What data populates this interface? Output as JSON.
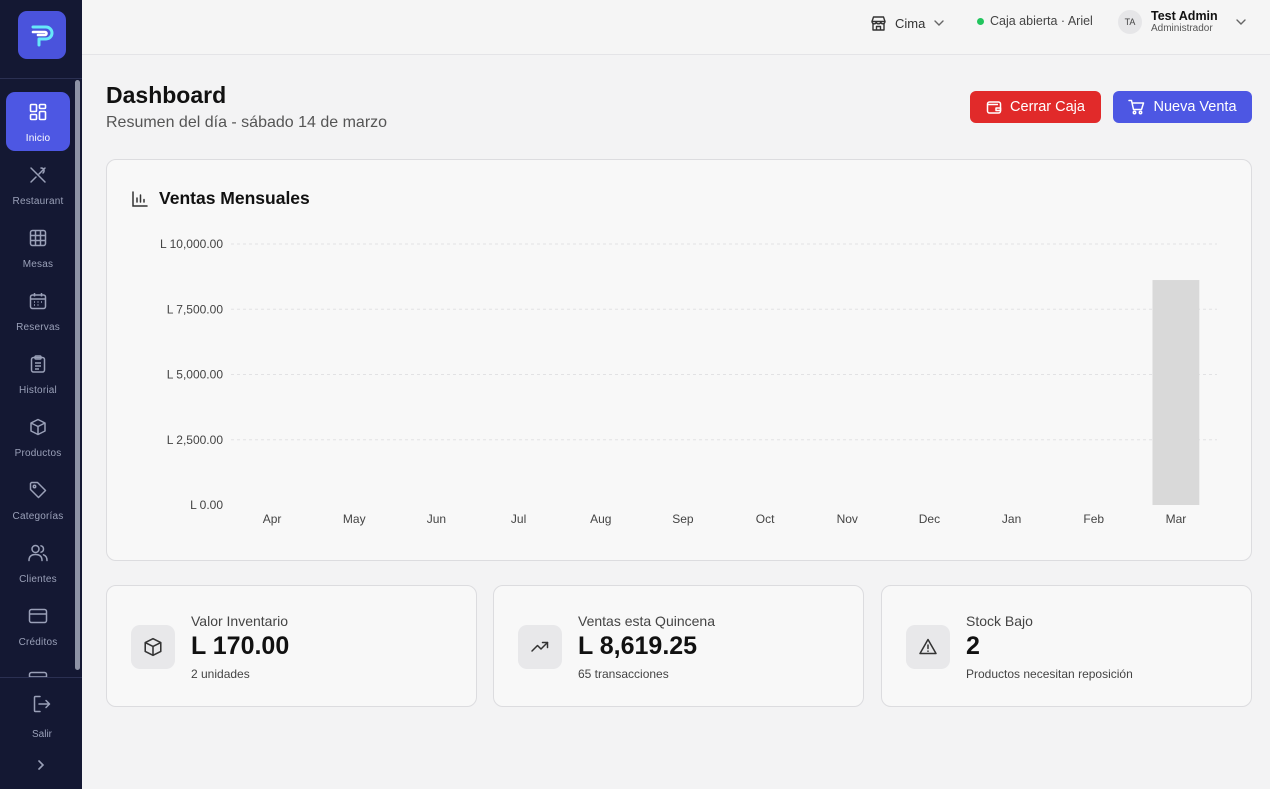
{
  "sidebar": {
    "logo": "P",
    "items": [
      {
        "label": "Inicio",
        "icon": "grid-icon",
        "active": true
      },
      {
        "label": "Restaurant",
        "icon": "utensils-icon"
      },
      {
        "label": "Mesas",
        "icon": "table-icon"
      },
      {
        "label": "Reservas",
        "icon": "calendar-icon"
      },
      {
        "label": "Historial",
        "icon": "clipboard-icon"
      },
      {
        "label": "Productos",
        "icon": "box-icon"
      },
      {
        "label": "Categorías",
        "icon": "tag-icon"
      },
      {
        "label": "Clientes",
        "icon": "users-icon"
      },
      {
        "label": "Créditos",
        "icon": "credit-card-icon"
      }
    ],
    "logout_label": "Salir"
  },
  "topbar": {
    "branch": "Cima",
    "status": "Caja abierta · Ariel",
    "status_color": "#22c55e",
    "user_initials": "TA",
    "user_name": "Test Admin",
    "user_role": "Administrador"
  },
  "header": {
    "title": "Dashboard",
    "subtitle": "Resumen del día - sábado 14 de marzo",
    "close_label": "Cerrar Caja",
    "new_sale_label": "Nueva Venta"
  },
  "colors": {
    "accent": "#4d57e3",
    "danger": "#e12a2a",
    "sidebar": "#141833",
    "bar": "#d9d9d9"
  },
  "chart_data": {
    "type": "bar",
    "title": "Ventas Mensuales",
    "categories": [
      "Apr",
      "May",
      "Jun",
      "Jul",
      "Aug",
      "Sep",
      "Oct",
      "Nov",
      "Dec",
      "Jan",
      "Feb",
      "Mar"
    ],
    "values": [
      0,
      0,
      0,
      0,
      0,
      0,
      0,
      0,
      0,
      0,
      0,
      8619.25
    ],
    "yticks": [
      0,
      2500,
      5000,
      7500,
      10000
    ],
    "ytick_labels": [
      "L 0.00",
      "L 2,500.00",
      "L 5,000.00",
      "L 7,500.00",
      "L 10,000.00"
    ],
    "ylim": [
      0,
      10000
    ],
    "grid": true
  },
  "stats": [
    {
      "label": "Valor Inventario",
      "value": "L 170.00",
      "note": "2 unidades",
      "icon": "box-icon"
    },
    {
      "label": "Ventas esta Quincena",
      "value": "L 8,619.25",
      "note": "65 transacciones",
      "icon": "trending-up-icon"
    },
    {
      "label": "Stock Bajo",
      "value": "2",
      "note": "Productos necesitan reposición",
      "icon": "alert-triangle-icon"
    }
  ]
}
